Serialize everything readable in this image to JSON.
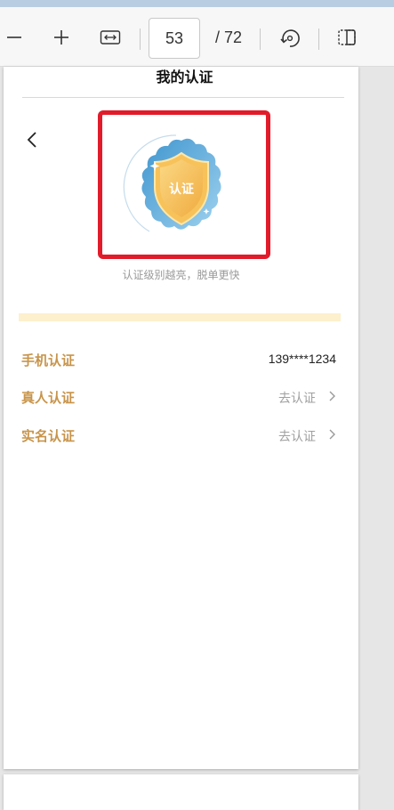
{
  "viewer": {
    "current_page": "53",
    "total_pages": "/ 72"
  },
  "app": {
    "title": "我的认证",
    "badge_text": "认证",
    "badge_caption": "认证级别越亮，脱单更快"
  },
  "verifications": [
    {
      "label": "手机认证",
      "value": "139****1234"
    },
    {
      "label": "真人认证",
      "action": "去认证"
    },
    {
      "label": "实名认证",
      "action": "去认证"
    }
  ],
  "colors": {
    "accent_gold": "#c8944a",
    "highlight_red": "#e21b2a",
    "cream": "#fdf0cd",
    "badge_blue": "#6fb3df",
    "shield_gold": "#f3b340"
  },
  "icons": {
    "zoom_out": "minus-icon",
    "zoom_in": "plus-icon",
    "fit_width": "fit-width-icon",
    "rotate": "rotate-icon",
    "page_view": "two-page-icon",
    "back": "chevron-left-icon",
    "row_arrow": "chevron-right-icon"
  }
}
